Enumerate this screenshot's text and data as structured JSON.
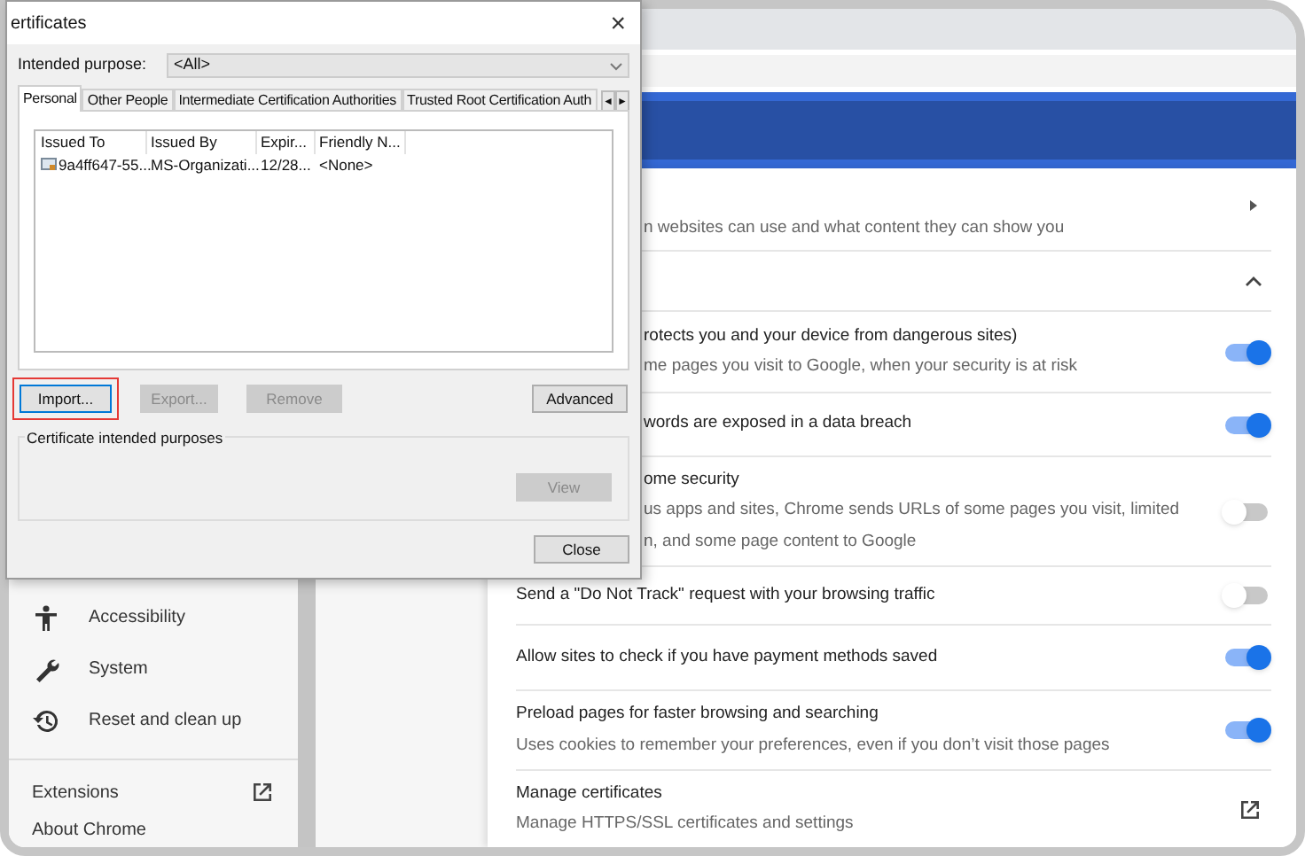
{
  "dialog": {
    "title": "ertificates",
    "close": "×",
    "intended_purpose": {
      "label": "Intended purpose:",
      "value": "<All>"
    },
    "tabs": [
      {
        "label": "Personal",
        "selected": true
      },
      {
        "label": "Other People",
        "selected": false
      },
      {
        "label": "Intermediate Certification Authorities",
        "selected": false
      },
      {
        "label": "Trusted Root Certification Auth",
        "selected": false
      }
    ],
    "tab_scroll": [
      "◄",
      "►"
    ],
    "table": {
      "columns": [
        "Issued To",
        "Issued By",
        "Expir...",
        "Friendly N..."
      ],
      "rows": [
        [
          "9a4ff647-55...",
          "MS-Organizati...",
          "12/28...",
          "<None>"
        ]
      ]
    },
    "buttons": [
      {
        "label": "Import...",
        "disabled": false,
        "highlighted": true
      },
      {
        "label": "Export...",
        "disabled": true,
        "highlighted": false
      },
      {
        "label": "Remove",
        "disabled": true,
        "highlighted": false
      }
    ],
    "advanced": "Advanced",
    "purposes": {
      "label": "Certificate intended purposes",
      "button": {
        "label": "View",
        "disabled": true
      }
    },
    "close_button": "Close"
  },
  "sidebar": {
    "items": [
      {
        "kind": "accessibility",
        "label": "Accessibility"
      },
      {
        "kind": "system",
        "label": "System"
      },
      {
        "kind": "reset",
        "label": "Reset and clean up"
      }
    ],
    "links": [
      {
        "label": "Extensions",
        "external": true
      },
      {
        "label": "About Chrome",
        "external": false
      }
    ]
  },
  "settings": [
    {
      "kind": "arrow",
      "description": [
        "n websites can use and what content they can show you"
      ]
    },
    {
      "kind": "expand",
      "expanded": true
    },
    {
      "kind": "toggle",
      "title": "rotects you and your device from dangerous sites)",
      "description": [
        "me pages you visit to Google, when your security is at risk"
      ],
      "on": true
    },
    {
      "kind": "toggle",
      "title": "words are exposed in a data breach",
      "on": true
    },
    {
      "kind": "toggle",
      "title": "ome security",
      "description": [
        "us apps and sites, Chrome sends URLs of some pages you visit, limited",
        "n, and some page content to Google"
      ],
      "on": false
    },
    {
      "kind": "toggle",
      "title": "Send a \"Do Not Track\" request with your browsing traffic",
      "on": false
    },
    {
      "kind": "toggle",
      "title": "Allow sites to check if you have payment methods saved",
      "on": true
    },
    {
      "kind": "toggle",
      "title": "Preload pages for faster browsing and searching",
      "description": [
        "Uses cookies to remember your preferences, even if you don’t visit those pages"
      ],
      "on": true
    },
    {
      "kind": "external",
      "title": "Manage certificates",
      "description": [
        "Manage HTTPS/SSL certificates and settings"
      ]
    }
  ]
}
